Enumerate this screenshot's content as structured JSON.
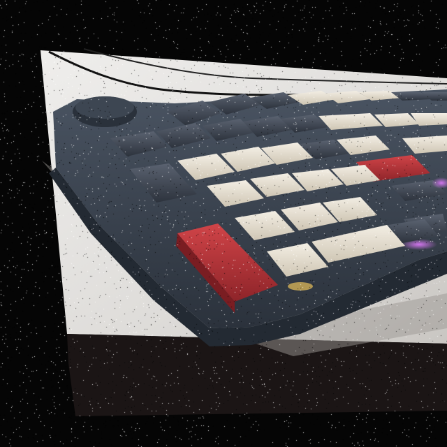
{
  "scene": {
    "subject": "mechanical-keyboard",
    "colors": {
      "background": "#050505",
      "desk": "#e4e2df",
      "desk_edge": "#1a1414",
      "case": "#3a4350",
      "key_dark": "#3c4450",
      "key_cream": "#e8e1d3",
      "key_red": "#b8363b",
      "rgb_glow": "#c44cf0"
    }
  }
}
